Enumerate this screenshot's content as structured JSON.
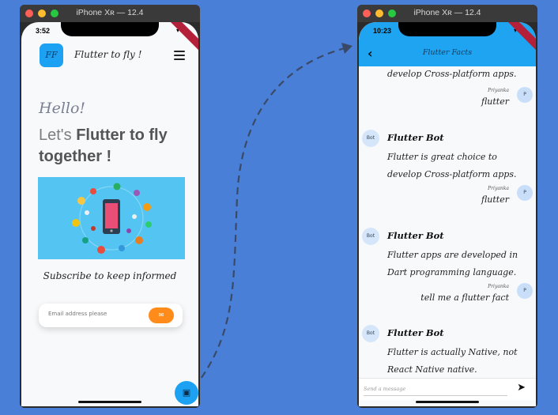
{
  "left_simulator": {
    "window_title": "iPhone Xʀ — 12.4",
    "status_time": "3:52",
    "status_icons": "▾ ▮",
    "app_bar": {
      "logo_text": "FF",
      "app_name": "Flutter to fly !"
    },
    "greeting": "Hello!",
    "tagline": {
      "prefix": "Let's ",
      "bold": "Flutter to fly together !"
    },
    "subscribe_label": "Subscribe to keep informed",
    "email_placeholder": "Email address please",
    "send_label": "✉",
    "fab_icon": "▣"
  },
  "right_simulator": {
    "window_title": "iPhone Xʀ — 12.4",
    "status_time": "10:23",
    "status_icons": "▾ ▮",
    "title": "Flutter Facts",
    "back_icon": "‹",
    "partial_top_text": "develop Cross-platform apps.",
    "messages": [
      {
        "type": "user",
        "avatar": "P",
        "name": "Priyanka",
        "text": "flutter"
      },
      {
        "type": "bot",
        "avatar": "Bot",
        "name": "Flutter Bot",
        "text": "Flutter is great choice to develop Cross-platform apps."
      },
      {
        "type": "user",
        "avatar": "P",
        "name": "Priyanka",
        "text": "flutter"
      },
      {
        "type": "bot",
        "avatar": "Bot",
        "name": "Flutter Bot",
        "text": "Flutter apps are developed in Dart programming language."
      },
      {
        "type": "user",
        "avatar": "P",
        "name": "Priyanka",
        "text": "tell me a flutter fact"
      },
      {
        "type": "bot",
        "avatar": "Bot",
        "name": "Flutter Bot",
        "text": "Flutter is actually Native, not React Native native."
      }
    ],
    "composer_placeholder": "Send a message",
    "send_icon": "➤"
  },
  "colors": {
    "background": "#4a7fd8",
    "accent": "#1da1f2",
    "orange": "#ff8c1a"
  }
}
